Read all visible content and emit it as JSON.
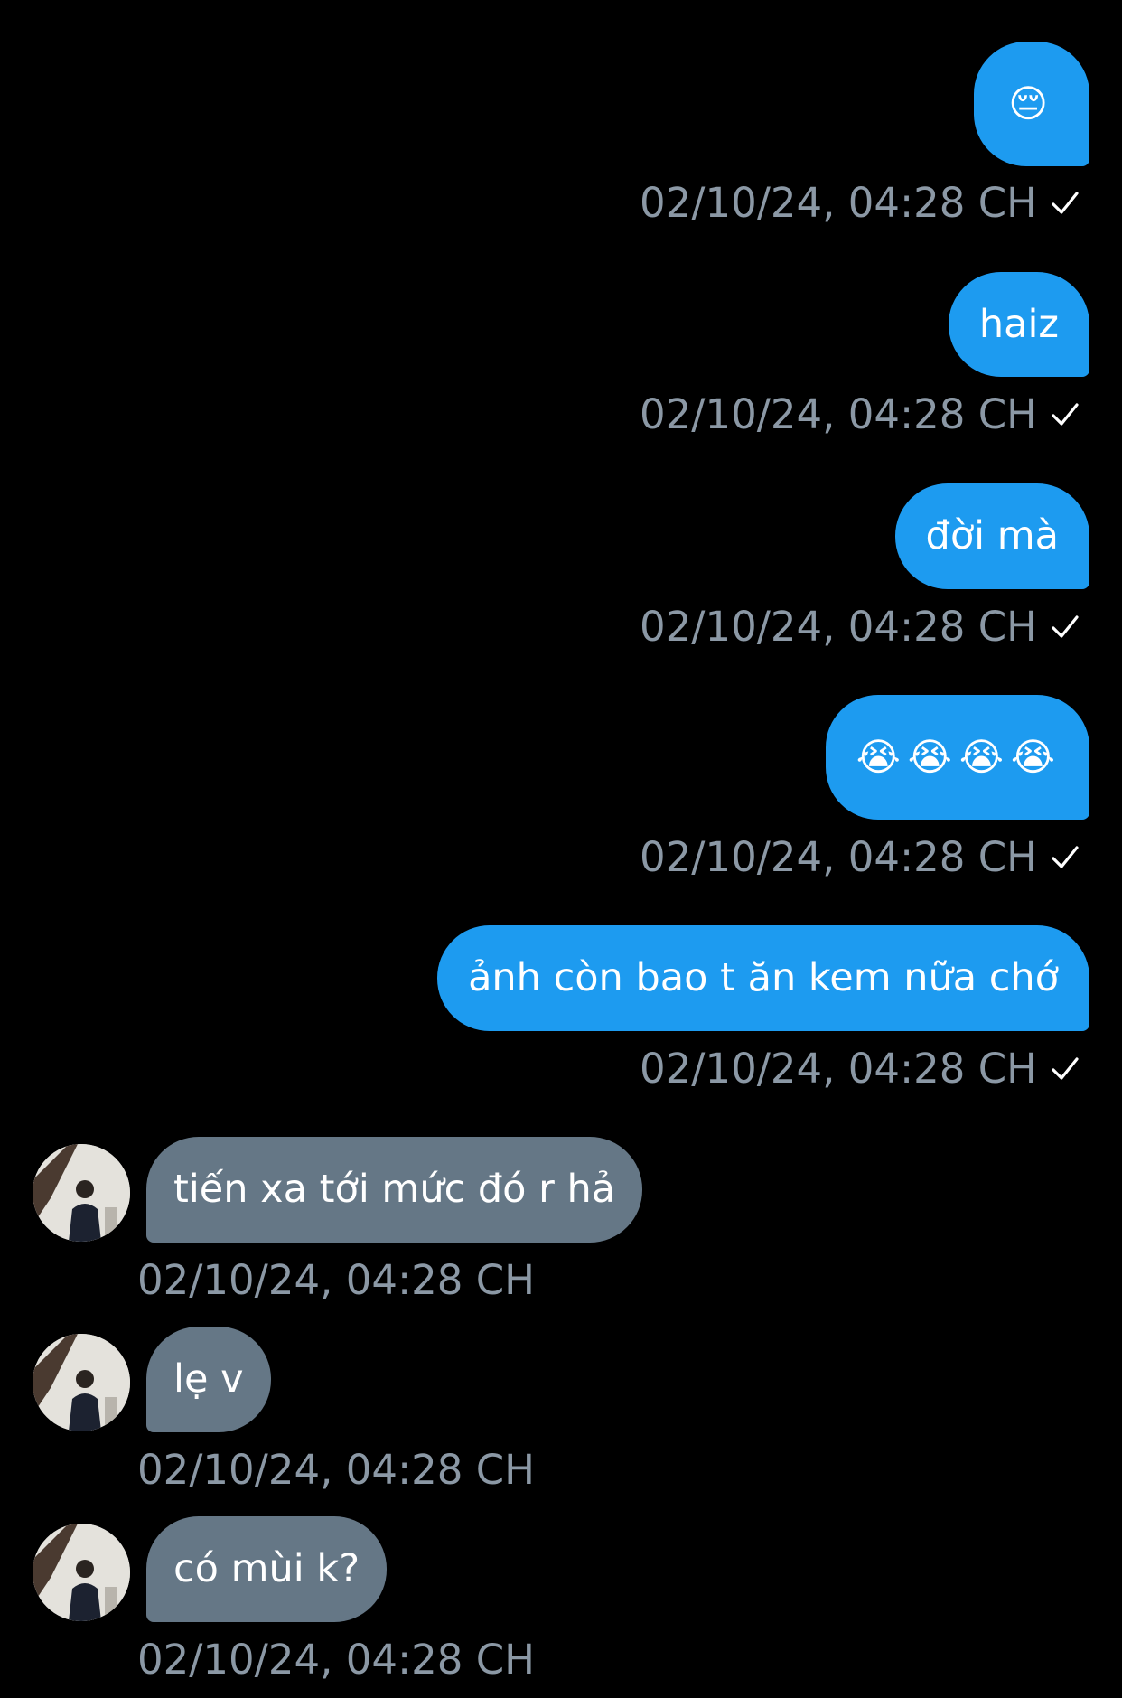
{
  "conversation": {
    "messages": [
      {
        "direction": "out",
        "text": "😔",
        "timestamp": "02/10/24, 04:28 CH",
        "status_icon": "check-icon"
      },
      {
        "direction": "out",
        "text": "haiz",
        "timestamp": "02/10/24, 04:28 CH",
        "status_icon": "check-icon"
      },
      {
        "direction": "out",
        "text": "đời mà",
        "timestamp": "02/10/24, 04:28 CH",
        "status_icon": "check-icon"
      },
      {
        "direction": "out",
        "text": "😭😭😭😭",
        "timestamp": "02/10/24, 04:28 CH",
        "status_icon": "check-icon"
      },
      {
        "direction": "out",
        "text": "ảnh còn bao t ăn kem nữa chớ",
        "timestamp": "02/10/24, 04:28 CH",
        "status_icon": "check-icon"
      },
      {
        "direction": "in",
        "text": "tiến xa tới mức đó r hả",
        "timestamp": "02/10/24, 04:28 CH",
        "avatar": "user-avatar"
      },
      {
        "direction": "in",
        "text": "lẹ v",
        "timestamp": "02/10/24, 04:28 CH",
        "avatar": "user-avatar"
      },
      {
        "direction": "in",
        "text": "có mùi k?",
        "timestamp": "02/10/24, 04:28 CH",
        "avatar": "user-avatar"
      }
    ]
  },
  "colors": {
    "background": "#000000",
    "outgoing_bubble": "#1d9bf0",
    "incoming_bubble": "#657786",
    "timestamp_text": "#8b98a5"
  }
}
